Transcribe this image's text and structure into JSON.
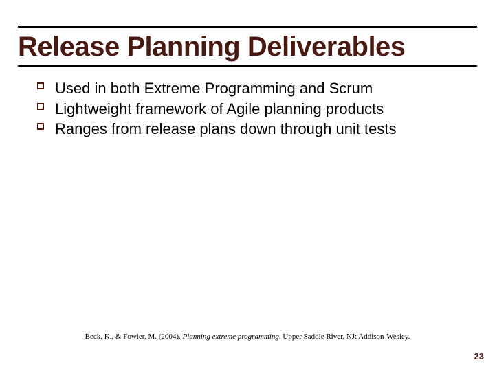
{
  "title": "Release Planning Deliverables",
  "bullets": [
    "Used in both Extreme Programming and Scrum",
    "Lightweight framework of Agile planning products",
    "Ranges from release plans down through unit tests"
  ],
  "citation": {
    "prefix": "Beck, K., & Fowler, M. (2004). ",
    "italic": "Planning extreme programming",
    "suffix": ". Upper Saddle River, NJ: Addison-Wesley."
  },
  "page_number": "23"
}
